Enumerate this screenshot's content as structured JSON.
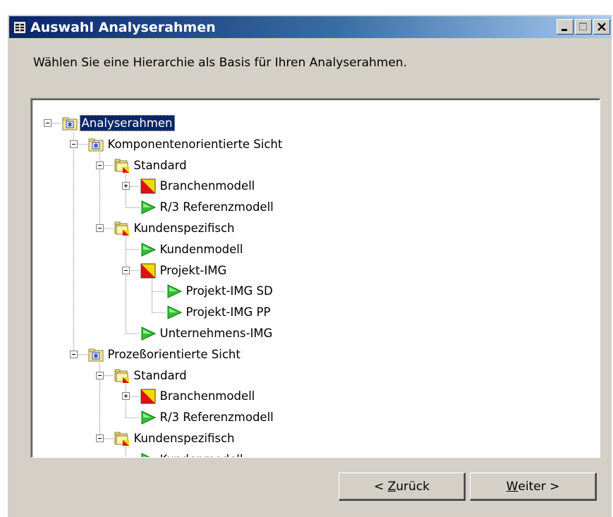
{
  "window": {
    "title": "Auswahl Analyserahmen"
  },
  "instruction": "Wählen Sie eine Hierarchie als Basis für Ihren Analyserahmen.",
  "tree": [
    {
      "label": "Analyserahmen",
      "icon": "star-folder-icon",
      "level": 0,
      "expander": "minus",
      "selected": true
    },
    {
      "label": "Komponentenorientierte Sicht",
      "icon": "star-folder-icon",
      "level": 1,
      "expander": "minus"
    },
    {
      "label": "Standard",
      "icon": "folder-flag-icon",
      "level": 2,
      "expander": "minus"
    },
    {
      "label": "Branchenmodell",
      "icon": "model-flag-icon",
      "level": 3,
      "expander": "plus"
    },
    {
      "label": "R/3 Referenzmodell",
      "icon": "green-arrow-icon",
      "level": 3,
      "expander": "none"
    },
    {
      "label": "Kundenspezifisch",
      "icon": "folder-flag-icon",
      "level": 2,
      "expander": "minus"
    },
    {
      "label": "Kundenmodell",
      "icon": "green-arrow-icon",
      "level": 3,
      "expander": "none"
    },
    {
      "label": "Projekt-IMG",
      "icon": "model-flag-icon",
      "level": 3,
      "expander": "minus"
    },
    {
      "label": "Projekt-IMG SD",
      "icon": "green-arrow-icon",
      "level": 4,
      "expander": "none"
    },
    {
      "label": "Projekt-IMG PP",
      "icon": "green-arrow-icon",
      "level": 4,
      "expander": "none"
    },
    {
      "label": "Unternehmens-IMG",
      "icon": "green-arrow-icon",
      "level": 3,
      "expander": "none"
    },
    {
      "label": "Prozeßorientierte Sicht",
      "icon": "star-folder-icon",
      "level": 1,
      "expander": "minus"
    },
    {
      "label": "Standard",
      "icon": "folder-flag-icon",
      "level": 2,
      "expander": "minus"
    },
    {
      "label": "Branchenmodell",
      "icon": "model-flag-icon",
      "level": 3,
      "expander": "plus"
    },
    {
      "label": "R/3 Referenzmodell",
      "icon": "green-arrow-icon",
      "level": 3,
      "expander": "none"
    },
    {
      "label": "Kundenspezifisch",
      "icon": "folder-flag-icon",
      "level": 2,
      "expander": "minus"
    },
    {
      "label": "Kundenmodell",
      "icon": "green-arrow-icon",
      "level": 3,
      "expander": "none"
    }
  ],
  "buttons": {
    "back": {
      "prefix": "< ",
      "mnemonic": "Z",
      "rest": "urück"
    },
    "next": {
      "mnemonic": "W",
      "rest": "eiter >"
    }
  },
  "colors": {
    "titlebar_start": "#0a246a",
    "titlebar_end": "#a6caf0",
    "dialog_bg": "#d4d0c8",
    "selection": "#0a246a"
  }
}
